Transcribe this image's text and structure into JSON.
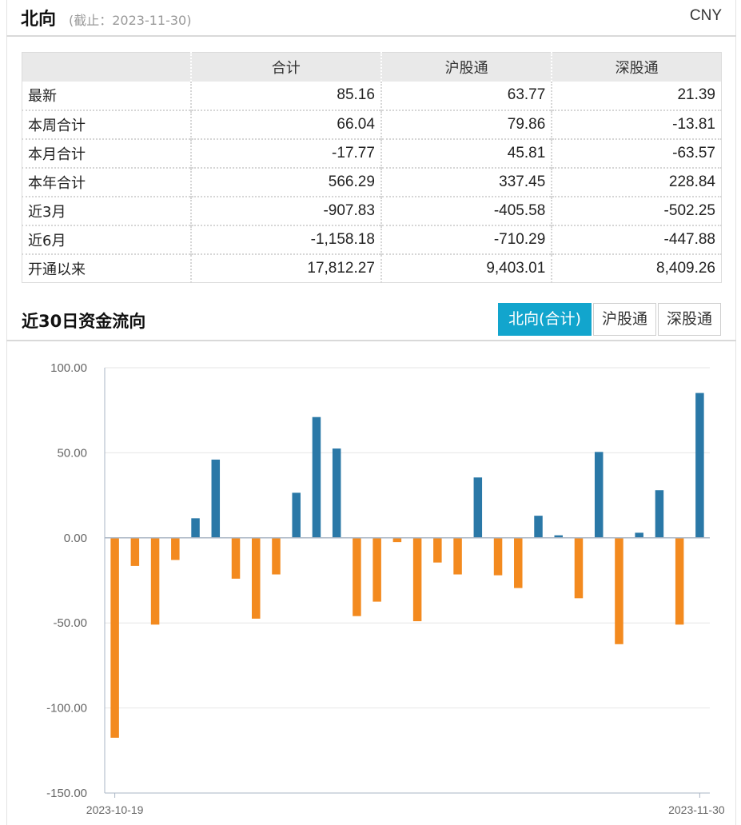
{
  "header": {
    "title": "北向",
    "as_of": "(截止：2023-11-30)",
    "currency": "CNY"
  },
  "summary_table": {
    "columns": [
      "",
      "合计",
      "沪股通",
      "深股通"
    ],
    "rows": [
      {
        "label": "最新",
        "total": "85.16",
        "sh": "63.77",
        "sz": "21.39"
      },
      {
        "label": "本周合计",
        "total": "66.04",
        "sh": "79.86",
        "sz": "-13.81"
      },
      {
        "label": "本月合计",
        "total": "-17.77",
        "sh": "45.81",
        "sz": "-63.57"
      },
      {
        "label": "本年合计",
        "total": "566.29",
        "sh": "337.45",
        "sz": "228.84"
      },
      {
        "label": "近3月",
        "total": "-907.83",
        "sh": "-405.58",
        "sz": "-502.25"
      },
      {
        "label": "近6月",
        "total": "-1,158.18",
        "sh": "-710.29",
        "sz": "-447.88"
      },
      {
        "label": "开通以来",
        "total": "17,812.27",
        "sh": "9,403.01",
        "sz": "8,409.26"
      }
    ]
  },
  "section": {
    "title": "近30日资金流向",
    "tabs": [
      {
        "label": "北向(合计)",
        "active": true
      },
      {
        "label": "沪股通",
        "active": false
      },
      {
        "label": "深股通",
        "active": false
      }
    ]
  },
  "colors": {
    "positive": "#2a78a7",
    "negative": "#f38a1f",
    "accent": "#12a5cd",
    "grid": "#e6e6e6",
    "axis": "#aab6c4"
  },
  "chart_data": {
    "type": "bar",
    "x_start_label": "2023-10-19",
    "x_end_label": "2023-11-30",
    "values": [
      -117.5,
      -16.5,
      -51,
      -13,
      11.5,
      46,
      -24,
      -47.5,
      -21.5,
      26.5,
      71,
      52.5,
      -46,
      -37.5,
      -2.5,
      -49,
      -14.5,
      -21.5,
      35.5,
      -22,
      -29.5,
      13,
      1.5,
      -35.5,
      50.5,
      -62.5,
      3,
      28,
      -51,
      85.16
    ],
    "yticks": [
      "100.00",
      "50.00",
      "0.00",
      "-50.00",
      "-100.00",
      "-150.00"
    ],
    "ylim": [
      -150,
      100
    ],
    "grid": true
  }
}
